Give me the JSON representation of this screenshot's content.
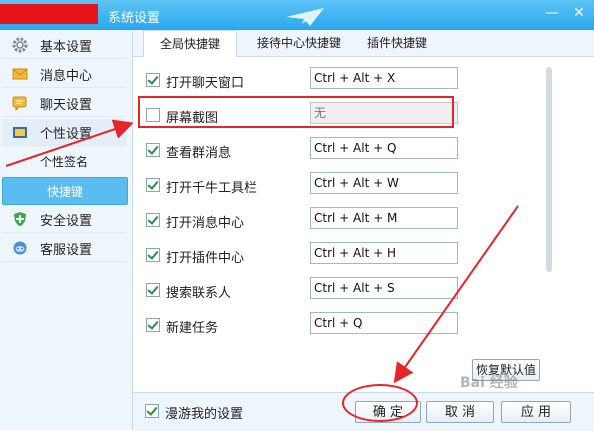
{
  "window": {
    "title": "系统设置",
    "minimize": "—",
    "close": "✕"
  },
  "sidebar": {
    "items": [
      {
        "label": "基本设置",
        "icon": "gear-icon"
      },
      {
        "label": "消息中心",
        "icon": "envelope-icon"
      },
      {
        "label": "聊天设置",
        "icon": "chat-bubble-icon"
      },
      {
        "label": "个性设置",
        "icon": "personalize-icon"
      }
    ],
    "subitems": [
      {
        "label": "个性签名"
      },
      {
        "label": "快捷键"
      }
    ],
    "items2": [
      {
        "label": "安全设置",
        "icon": "shield-icon"
      },
      {
        "label": "客服设置",
        "icon": "headset-icon"
      }
    ]
  },
  "tabs": [
    {
      "label": "全局快捷键"
    },
    {
      "label": "接待中心快捷键"
    },
    {
      "label": "插件快捷键"
    }
  ],
  "shortcuts": [
    {
      "label": "打开聊天窗口",
      "key": "Ctrl + Alt + X",
      "checked": true
    },
    {
      "label": "屏幕截图",
      "key": "无",
      "checked": false
    },
    {
      "label": "查看群消息",
      "key": "Ctrl + Alt + Q",
      "checked": true
    },
    {
      "label": "打开千牛工具栏",
      "key": "Ctrl + Alt + W",
      "checked": true
    },
    {
      "label": "打开消息中心",
      "key": "Ctrl + Alt + M",
      "checked": true
    },
    {
      "label": "打开插件中心",
      "key": "Ctrl + Alt + H",
      "checked": true
    },
    {
      "label": "搜索联系人",
      "key": "Ctrl + Alt + S",
      "checked": true
    },
    {
      "label": "新建任务",
      "key": "Ctrl + Q",
      "checked": true
    }
  ],
  "buttons": {
    "restore": "恢复默认值",
    "ok": "确 定",
    "cancel": "取 消",
    "apply": "应 用"
  },
  "roaming": {
    "label": "漫游我的设置",
    "checked": true
  },
  "watermark": "Bai 经验",
  "colors": {
    "titlebar": "#2aa7ee",
    "accent": "#5bbcf0",
    "annotation": "#e5252a"
  }
}
